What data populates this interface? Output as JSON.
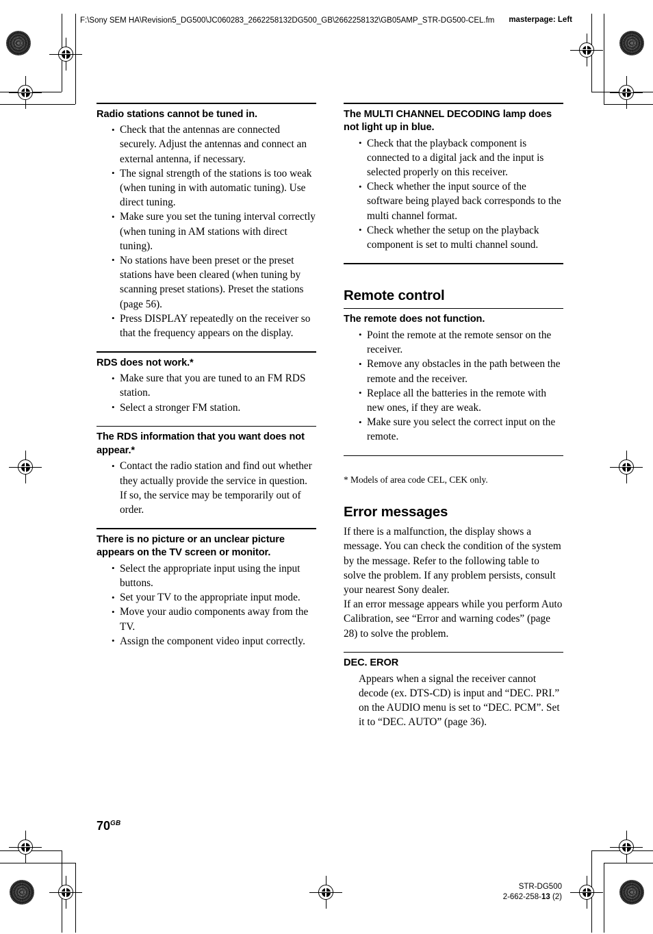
{
  "header": {
    "filepath": "F:\\Sony SEM HA\\Revision5_DG500\\JC060283_2662258132DG500_GB\\2662258132\\GB05AMP_STR-DG500-CEL.fm",
    "masterpage": "masterpage: Left"
  },
  "left_column": {
    "sections": [
      {
        "heading": "Radio stations cannot be tuned in.",
        "bullets": [
          "Check that the antennas are connected securely. Adjust the antennas and connect an external antenna, if necessary.",
          "The signal strength of the stations is too weak (when tuning in with automatic tuning). Use direct tuning.",
          "Make sure you set the tuning interval correctly (when tuning in AM stations with direct tuning).",
          "No stations have been preset or the preset stations have been cleared (when tuning by scanning preset stations). Preset the stations (page 56).",
          "Press DISPLAY repeatedly on the receiver so that the frequency appears on the display."
        ]
      },
      {
        "heading": "RDS does not work.*",
        "bullets": [
          "Make sure that you are tuned to an FM RDS station.",
          "Select a stronger FM station."
        ]
      },
      {
        "heading": "The RDS information that you want does not appear.*",
        "bullets": [
          "Contact the radio station and find out whether they actually provide the service in question. If so, the service may be temporarily out of order."
        ]
      },
      {
        "heading": "There is no picture or an unclear picture appears on the TV screen or monitor.",
        "bullets": [
          "Select the appropriate input using the input buttons.",
          "Set your TV to the appropriate input mode.",
          "Move your audio components away from the TV.",
          "Assign the component video input correctly."
        ]
      }
    ]
  },
  "right_column": {
    "multi_channel": {
      "heading": "The MULTI CHANNEL DECODING lamp does not light up in blue.",
      "bullets": [
        "Check that the playback component is connected to a digital jack and the input is selected properly on this receiver.",
        "Check whether the input source of the software being played back corresponds to the multi channel format.",
        "Check whether the setup on the playback component is set to multi channel sound."
      ]
    },
    "remote_control": {
      "section_title": "Remote control",
      "heading": "The remote does not function.",
      "bullets": [
        "Point the remote at the remote sensor on the receiver.",
        "Remove any obstacles in the path between the remote and the receiver.",
        "Replace all the batteries in the remote with new ones, if they are weak.",
        "Make sure you select the correct input on the remote."
      ]
    },
    "footnote": "* Models of area code CEL, CEK only.",
    "error_messages": {
      "section_title": "Error messages",
      "intro": "If there is a malfunction, the display shows a message. You can check the condition of the system by the message. Refer to the following table to solve the problem. If any problem persists, consult your nearest Sony dealer.",
      "intro2": "If an error message appears while you perform Auto Calibration, see “Error and warning codes” (page 28) to solve the problem.",
      "entry_heading": "DEC. EROR",
      "entry_body": "Appears when a signal the receiver cannot decode (ex. DTS-CD) is input and “DEC. PRI.” on the AUDIO menu is set to “DEC. PCM”. Set it to “DEC. AUTO” (page 36)."
    }
  },
  "footer": {
    "page_number": "70",
    "page_suffix": "GB",
    "model": "STR-DG500",
    "code_prefix": "2-662-258-",
    "code_bold": "13",
    "code_suffix": " (2)"
  }
}
